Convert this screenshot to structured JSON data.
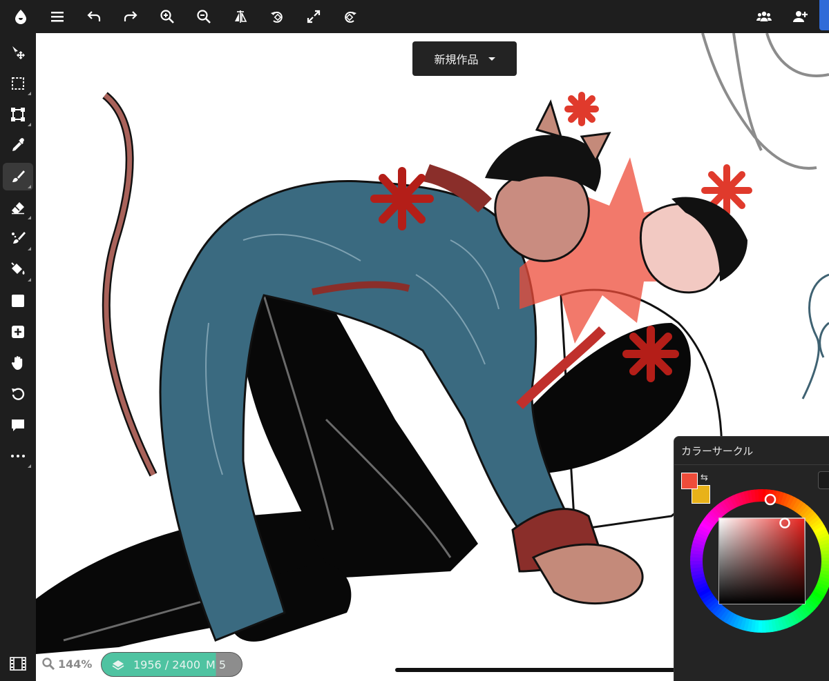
{
  "document": {
    "title": "新規作品"
  },
  "status": {
    "zoom": "144%",
    "layer_counter": "1956 / 2400",
    "layer_suffix": "M 5"
  },
  "color_panel": {
    "title": "カラーサークル",
    "main_color": "#ee4c3a",
    "sub_color": "#e8b219",
    "swap_glyph": "⇆"
  },
  "colors": {
    "toolbar_bg": "#1e1e1e",
    "accent_blue": "#2f6bd8",
    "layer_pill": "#4fc3a1"
  },
  "icons": {
    "top": [
      "app-logo-icon",
      "menu-icon",
      "undo-icon",
      "redo-icon",
      "zoom-in-icon",
      "zoom-out-icon",
      "flip-icon",
      "rotate-left-icon",
      "fullscreen-icon",
      "rotate-right-icon",
      "group-icon",
      "add-user-icon"
    ],
    "tools": [
      "move-icon",
      "selection-icon",
      "transform-icon",
      "eyedropper-icon",
      "brush-icon",
      "eraser-icon",
      "blur-brush-icon",
      "fill-icon",
      "shape-icon",
      "add-icon",
      "hand-icon",
      "rotate-canvas-icon",
      "comment-icon",
      "more-icon"
    ]
  }
}
